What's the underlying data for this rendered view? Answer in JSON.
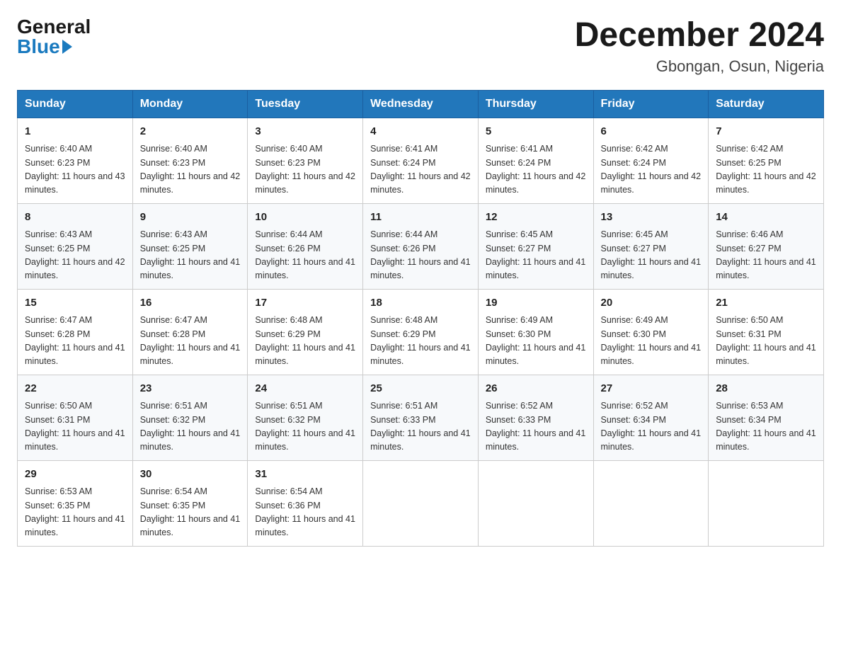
{
  "logo": {
    "general": "General",
    "blue": "Blue"
  },
  "title": {
    "month": "December 2024",
    "location": "Gbongan, Osun, Nigeria"
  },
  "days_header": [
    "Sunday",
    "Monday",
    "Tuesday",
    "Wednesday",
    "Thursday",
    "Friday",
    "Saturday"
  ],
  "weeks": [
    [
      {
        "day": "1",
        "sunrise": "6:40 AM",
        "sunset": "6:23 PM",
        "daylight": "11 hours and 43 minutes."
      },
      {
        "day": "2",
        "sunrise": "6:40 AM",
        "sunset": "6:23 PM",
        "daylight": "11 hours and 42 minutes."
      },
      {
        "day": "3",
        "sunrise": "6:40 AM",
        "sunset": "6:23 PM",
        "daylight": "11 hours and 42 minutes."
      },
      {
        "day": "4",
        "sunrise": "6:41 AM",
        "sunset": "6:24 PM",
        "daylight": "11 hours and 42 minutes."
      },
      {
        "day": "5",
        "sunrise": "6:41 AM",
        "sunset": "6:24 PM",
        "daylight": "11 hours and 42 minutes."
      },
      {
        "day": "6",
        "sunrise": "6:42 AM",
        "sunset": "6:24 PM",
        "daylight": "11 hours and 42 minutes."
      },
      {
        "day": "7",
        "sunrise": "6:42 AM",
        "sunset": "6:25 PM",
        "daylight": "11 hours and 42 minutes."
      }
    ],
    [
      {
        "day": "8",
        "sunrise": "6:43 AM",
        "sunset": "6:25 PM",
        "daylight": "11 hours and 42 minutes."
      },
      {
        "day": "9",
        "sunrise": "6:43 AM",
        "sunset": "6:25 PM",
        "daylight": "11 hours and 41 minutes."
      },
      {
        "day": "10",
        "sunrise": "6:44 AM",
        "sunset": "6:26 PM",
        "daylight": "11 hours and 41 minutes."
      },
      {
        "day": "11",
        "sunrise": "6:44 AM",
        "sunset": "6:26 PM",
        "daylight": "11 hours and 41 minutes."
      },
      {
        "day": "12",
        "sunrise": "6:45 AM",
        "sunset": "6:27 PM",
        "daylight": "11 hours and 41 minutes."
      },
      {
        "day": "13",
        "sunrise": "6:45 AM",
        "sunset": "6:27 PM",
        "daylight": "11 hours and 41 minutes."
      },
      {
        "day": "14",
        "sunrise": "6:46 AM",
        "sunset": "6:27 PM",
        "daylight": "11 hours and 41 minutes."
      }
    ],
    [
      {
        "day": "15",
        "sunrise": "6:47 AM",
        "sunset": "6:28 PM",
        "daylight": "11 hours and 41 minutes."
      },
      {
        "day": "16",
        "sunrise": "6:47 AM",
        "sunset": "6:28 PM",
        "daylight": "11 hours and 41 minutes."
      },
      {
        "day": "17",
        "sunrise": "6:48 AM",
        "sunset": "6:29 PM",
        "daylight": "11 hours and 41 minutes."
      },
      {
        "day": "18",
        "sunrise": "6:48 AM",
        "sunset": "6:29 PM",
        "daylight": "11 hours and 41 minutes."
      },
      {
        "day": "19",
        "sunrise": "6:49 AM",
        "sunset": "6:30 PM",
        "daylight": "11 hours and 41 minutes."
      },
      {
        "day": "20",
        "sunrise": "6:49 AM",
        "sunset": "6:30 PM",
        "daylight": "11 hours and 41 minutes."
      },
      {
        "day": "21",
        "sunrise": "6:50 AM",
        "sunset": "6:31 PM",
        "daylight": "11 hours and 41 minutes."
      }
    ],
    [
      {
        "day": "22",
        "sunrise": "6:50 AM",
        "sunset": "6:31 PM",
        "daylight": "11 hours and 41 minutes."
      },
      {
        "day": "23",
        "sunrise": "6:51 AM",
        "sunset": "6:32 PM",
        "daylight": "11 hours and 41 minutes."
      },
      {
        "day": "24",
        "sunrise": "6:51 AM",
        "sunset": "6:32 PM",
        "daylight": "11 hours and 41 minutes."
      },
      {
        "day": "25",
        "sunrise": "6:51 AM",
        "sunset": "6:33 PM",
        "daylight": "11 hours and 41 minutes."
      },
      {
        "day": "26",
        "sunrise": "6:52 AM",
        "sunset": "6:33 PM",
        "daylight": "11 hours and 41 minutes."
      },
      {
        "day": "27",
        "sunrise": "6:52 AM",
        "sunset": "6:34 PM",
        "daylight": "11 hours and 41 minutes."
      },
      {
        "day": "28",
        "sunrise": "6:53 AM",
        "sunset": "6:34 PM",
        "daylight": "11 hours and 41 minutes."
      }
    ],
    [
      {
        "day": "29",
        "sunrise": "6:53 AM",
        "sunset": "6:35 PM",
        "daylight": "11 hours and 41 minutes."
      },
      {
        "day": "30",
        "sunrise": "6:54 AM",
        "sunset": "6:35 PM",
        "daylight": "11 hours and 41 minutes."
      },
      {
        "day": "31",
        "sunrise": "6:54 AM",
        "sunset": "6:36 PM",
        "daylight": "11 hours and 41 minutes."
      },
      null,
      null,
      null,
      null
    ]
  ],
  "labels": {
    "sunrise_prefix": "Sunrise: ",
    "sunset_prefix": "Sunset: ",
    "daylight_prefix": "Daylight: "
  }
}
